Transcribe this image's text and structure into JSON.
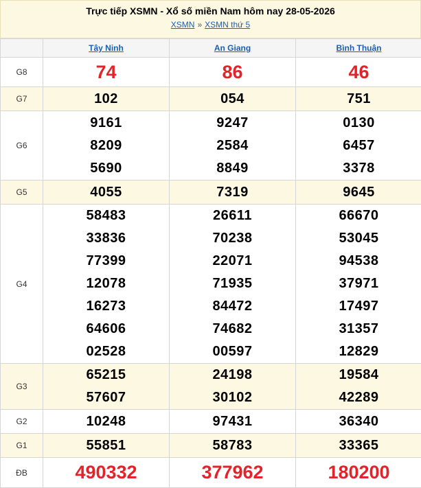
{
  "header": {
    "title": "Trực tiếp XSMN - Xổ số miền Nam hôm nay 28-05-2026",
    "crumb_1": "XSMN",
    "crumb_sep": "»",
    "crumb_2": "XSMN thứ 5"
  },
  "provinces": [
    "Tây Ninh",
    "An Giang",
    "Bình Thuận"
  ],
  "prizes": {
    "g8": {
      "label": "G8",
      "values": [
        "74",
        "86",
        "46"
      ]
    },
    "g7": {
      "label": "G7",
      "values": [
        "102",
        "054",
        "751"
      ]
    },
    "g6": {
      "label": "G6",
      "values": [
        [
          "9161",
          "8209",
          "5690"
        ],
        [
          "9247",
          "2584",
          "8849"
        ],
        [
          "0130",
          "6457",
          "3378"
        ]
      ]
    },
    "g5": {
      "label": "G5",
      "values": [
        "4055",
        "7319",
        "9645"
      ]
    },
    "g4": {
      "label": "G4",
      "values": [
        [
          "58483",
          "33836",
          "77399",
          "12078",
          "16273",
          "64606",
          "02528"
        ],
        [
          "26611",
          "70238",
          "22071",
          "71935",
          "84472",
          "74682",
          "00597"
        ],
        [
          "66670",
          "53045",
          "94538",
          "37971",
          "17497",
          "31357",
          "12829"
        ]
      ]
    },
    "g3": {
      "label": "G3",
      "values": [
        [
          "65215",
          "57607"
        ],
        [
          "24198",
          "30102"
        ],
        [
          "19584",
          "42289"
        ]
      ]
    },
    "g2": {
      "label": "G2",
      "values": [
        "10248",
        "97431",
        "36340"
      ]
    },
    "g1": {
      "label": "G1",
      "values": [
        "55851",
        "58783",
        "33365"
      ]
    },
    "db": {
      "label": "ĐB",
      "values": [
        "490332",
        "377962",
        "180200"
      ]
    }
  },
  "colors": {
    "accent_red": "#e2232a",
    "link_blue": "#1a5fb4",
    "shade": "#fdf8e1"
  }
}
